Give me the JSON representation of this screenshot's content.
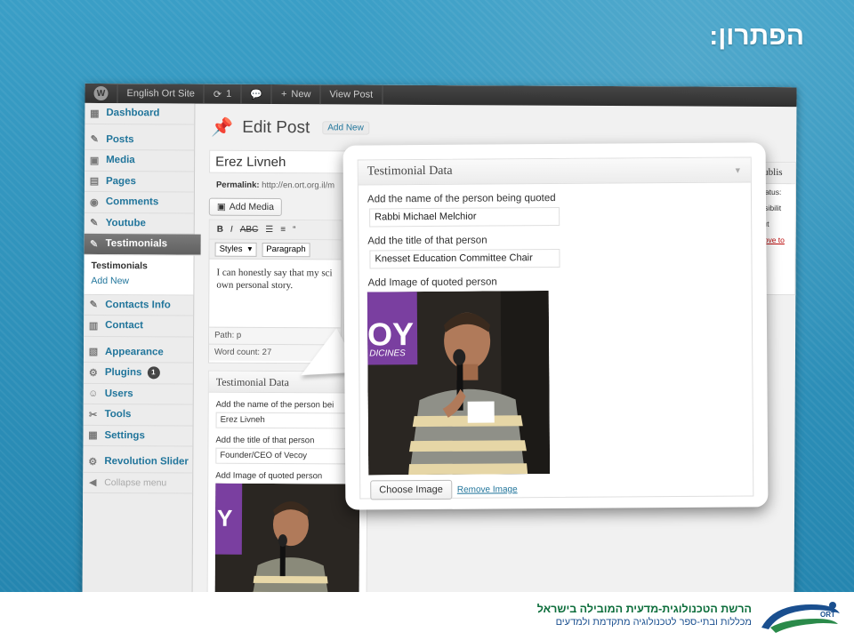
{
  "slide": {
    "title": "הפתרון:"
  },
  "adminbar": {
    "site_name": "English Ort Site",
    "updates_count": "1",
    "new_label": "New",
    "view_post_label": "View Post"
  },
  "sidebar": {
    "items": [
      {
        "label": "Dashboard",
        "icon": "dashboard-icon"
      },
      {
        "label": "Posts",
        "icon": "pin-icon"
      },
      {
        "label": "Media",
        "icon": "media-icon"
      },
      {
        "label": "Pages",
        "icon": "pages-icon"
      },
      {
        "label": "Comments",
        "icon": "comments-icon"
      },
      {
        "label": "Youtube",
        "icon": "pin-icon"
      },
      {
        "label": "Testimonials",
        "icon": "pin-icon"
      }
    ],
    "submenu": {
      "current": "Testimonials",
      "add_new": "Add New"
    },
    "items2": [
      {
        "label": "Contacts Info",
        "icon": "pin-icon"
      },
      {
        "label": "Contact",
        "icon": "contact-icon"
      }
    ],
    "items3": [
      {
        "label": "Appearance",
        "icon": "appearance-icon"
      },
      {
        "label": "Plugins",
        "icon": "plugins-icon",
        "badge": "1"
      },
      {
        "label": "Users",
        "icon": "users-icon"
      },
      {
        "label": "Tools",
        "icon": "tools-icon"
      },
      {
        "label": "Settings",
        "icon": "settings-icon"
      }
    ],
    "revolution": "Revolution Slider",
    "collapse": "Collapse menu"
  },
  "editor": {
    "page_title": "Edit Post",
    "add_new": "Add New",
    "post_title": "Erez Livneh",
    "permalink_label": "Permalink:",
    "permalink_value": "http://en.ort.org.il/m",
    "add_media": "Add Media",
    "styles_select": "Styles",
    "format_select": "Paragraph",
    "body_text": "I can honestly say that my sci own personal story.",
    "path": "Path: p",
    "word_count": "Word count: 27"
  },
  "metabox_small": {
    "title": "Testimonial Data",
    "name_label": "Add the name of the person bei",
    "name_value": "Erez Livneh",
    "title_label": "Add the title of that person",
    "title_value": "Founder/CEO of Vecoy",
    "image_label": "Add Image of quoted person"
  },
  "publish": {
    "title": "Publis",
    "status": "Status:",
    "visibility": "Visibilit",
    "publish_row": "Put",
    "trash": "Move to"
  },
  "callout": {
    "title": "Testimonial Data",
    "name_label": "Add the name of the person being quoted",
    "name_value": "Rabbi Michael Melchior",
    "title_label": "Add the title of that person",
    "title_value": "Knesset Education Committee Chair",
    "image_label": "Add Image of quoted person",
    "choose_image": "Choose Image",
    "remove_image": "Remove Image"
  },
  "footer": {
    "line1": "הרשת הטכנולוגית-מדעית המובילה בישראל",
    "line2": "מכללות ובתי-ספר לטכנולוגיה מתקדמת ולמדעים",
    "logo_text": "ORT"
  },
  "colors": {
    "link": "#21759b",
    "adminbar": "#464646",
    "background": "#2c8fb8"
  }
}
